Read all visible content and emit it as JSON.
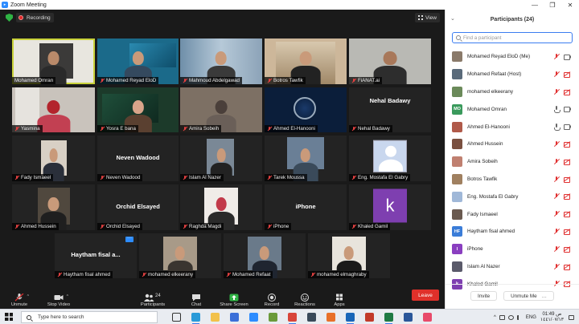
{
  "window": {
    "title": "Zoom Meeting",
    "minimize_icon": "minimize-icon",
    "maximize_icon": "maximize-icon",
    "close_icon": "close-icon"
  },
  "meeting": {
    "recording_label": "Recording",
    "view_label": "View",
    "tiles": [
      {
        "name": "Mohamed Omran",
        "type": "video",
        "active": true
      },
      {
        "name": "Mohamed Reyad EloD",
        "type": "video"
      },
      {
        "name": "Mahmoud Abdelgawad",
        "type": "video"
      },
      {
        "name": "Botros Tawfik",
        "type": "video"
      },
      {
        "name": "FiANAT.ai",
        "type": "video"
      },
      {
        "name": "Yasmina",
        "type": "video"
      },
      {
        "name": "Yosra E bana",
        "type": "video"
      },
      {
        "name": "Amira Sobeih",
        "type": "video"
      },
      {
        "name": "Ahmed El-Hanooni",
        "type": "video"
      },
      {
        "name": "Nehal Badawy",
        "type": "name",
        "big": "Nehal Badawy"
      },
      {
        "name": "Fady Ismaeel",
        "type": "video"
      },
      {
        "name": "Neven Wadood",
        "type": "name",
        "big": "Neven Wadood"
      },
      {
        "name": "Islam Al Nazer",
        "type": "video"
      },
      {
        "name": "Tarek Moussa",
        "type": "video"
      },
      {
        "name": "Eng. Mostafa El Gabry",
        "type": "avatar"
      },
      {
        "name": "Ahmed Hussein",
        "type": "video"
      },
      {
        "name": "Orchid Elsayed",
        "type": "name",
        "big": "Orchid Elsayed"
      },
      {
        "name": "Raghda Magdi",
        "type": "video"
      },
      {
        "name": "iPhone",
        "type": "name",
        "big": "iPhone"
      },
      {
        "name": "Khaled Gamil",
        "type": "letter",
        "letter": "k"
      },
      {
        "name": "Haytham fisal ahmed",
        "type": "name",
        "big": "Haytham fisal a..."
      },
      {
        "name": "mohamed elkeerany",
        "type": "video"
      },
      {
        "name": "Mohamed Refaat",
        "type": "video"
      },
      {
        "name": "mohamed elmaghraby",
        "type": "video"
      }
    ]
  },
  "toolbar": {
    "unmute": "Unmute",
    "stop_video": "Stop Video",
    "participants": "Participants",
    "participants_count": "24",
    "chat": "Chat",
    "share_screen": "Share Screen",
    "record": "Record",
    "reactions": "Reactions",
    "apps": "Apps",
    "leave": "Leave"
  },
  "participants_panel": {
    "title": "Participants (24)",
    "search_placeholder": "Find a participant",
    "list": [
      {
        "name": "Mohamed Reyad EloD (Me)",
        "initials": "",
        "color": "#8a7a6a",
        "mic": "off",
        "cam": "on"
      },
      {
        "name": "Mohamed Refaat (Host)",
        "initials": "",
        "color": "#5a6a7a",
        "mic": "off-host",
        "cam": "off"
      },
      {
        "name": "mohamed elkeerany",
        "initials": "",
        "color": "#6b8a5a",
        "mic": "off",
        "cam": "off"
      },
      {
        "name": "Mohamed Omran",
        "initials": "MO",
        "color": "#3a9a5c",
        "mic": "on",
        "cam": "on"
      },
      {
        "name": "Ahmed El-Hanooni",
        "initials": "",
        "color": "#b05a4a",
        "mic": "on",
        "cam": "on"
      },
      {
        "name": "Ahmed Hussein",
        "initials": "",
        "color": "#7a5040",
        "mic": "off",
        "cam": "off"
      },
      {
        "name": "Amira Sobeih",
        "initials": "",
        "color": "#c08070",
        "mic": "off",
        "cam": "off"
      },
      {
        "name": "Botros Tawfik",
        "initials": "",
        "color": "#a08060",
        "mic": "off",
        "cam": "off"
      },
      {
        "name": "Eng. Mostafa El Gabry",
        "initials": "",
        "color": "#a0b8d8",
        "mic": "off",
        "cam": "off"
      },
      {
        "name": "Fady Ismaeel",
        "initials": "",
        "color": "#6a5a50",
        "mic": "off",
        "cam": "off"
      },
      {
        "name": "Haytham fisal ahmed",
        "initials": "HF",
        "color": "#3b7dd8",
        "mic": "off",
        "cam": "off"
      },
      {
        "name": "iPhone",
        "initials": "I",
        "color": "#8a3fc0",
        "mic": "off",
        "cam": "off"
      },
      {
        "name": "Islam Al Nazer",
        "initials": "",
        "color": "#5a5a6a",
        "mic": "off",
        "cam": "off"
      },
      {
        "name": "Khaled Gamil",
        "initials": "k",
        "color": "#7e3fb0",
        "mic": "off",
        "cam": "off"
      }
    ],
    "invite": "Invite",
    "unmute_me": "Unmute Me"
  },
  "taskbar": {
    "search_placeholder": "Type here to search",
    "time": "01:49 ص",
    "date": "١٤٤١/٠٧/١٣",
    "lang": "ENG"
  },
  "colors": {
    "accent": "#2d8cff",
    "leave": "#e0302a",
    "active_speaker": "#c9d23a",
    "share": "#2fb344"
  }
}
